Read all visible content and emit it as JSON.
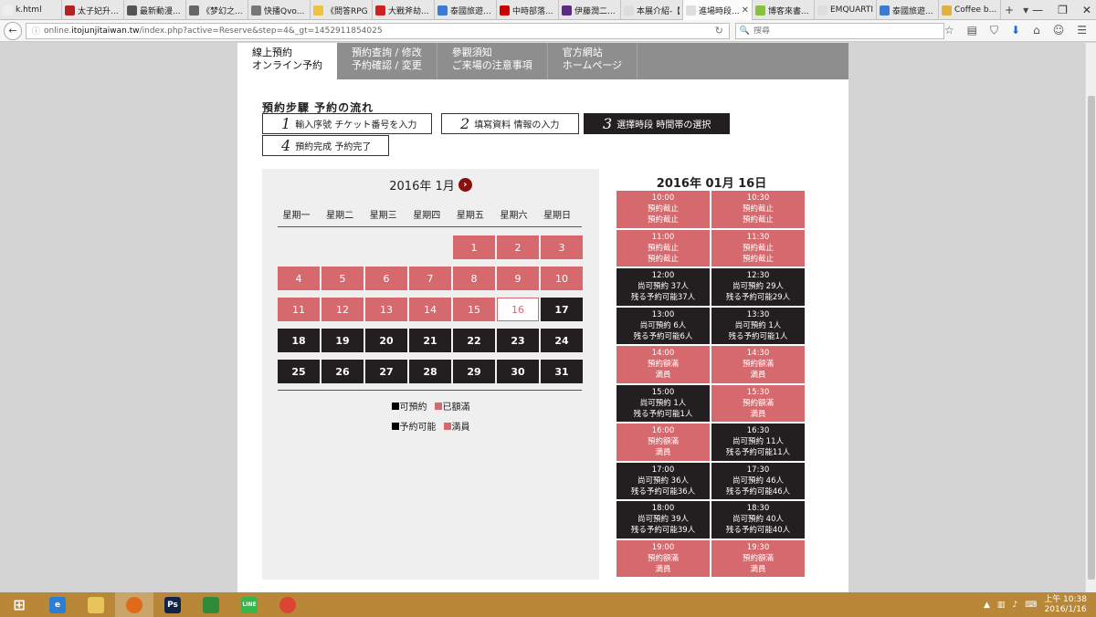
{
  "browser": {
    "tabs": [
      {
        "title": "k.html",
        "color": "#eeeeee"
      },
      {
        "title": "太子妃升...",
        "color": "#b22222"
      },
      {
        "title": "最新動漫...",
        "color": "#555555"
      },
      {
        "title": "《梦幻之...",
        "color": "#666666"
      },
      {
        "title": "快播Qvo...",
        "color": "#777777"
      },
      {
        "title": "《問答RPG ...",
        "color": "#f0c040"
      },
      {
        "title": "大戰斧劫...",
        "color": "#cc2222"
      },
      {
        "title": "泰國旅遊...",
        "color": "#3b7bd4"
      },
      {
        "title": "中時部落...",
        "color": "#cc0000"
      },
      {
        "title": "伊藤潤二...",
        "color": "#5b2a86"
      },
      {
        "title": "本展介紹-【...",
        "color": "#dddddd"
      },
      {
        "title": "進場時段...",
        "color": "#dddddd",
        "active": true
      },
      {
        "title": "博客來書...",
        "color": "#88c040"
      },
      {
        "title": "EMQUARTIER",
        "color": "#dddddd"
      },
      {
        "title": "泰國旅遊...",
        "color": "#3b7bd4"
      },
      {
        "title": "Coffee b...",
        "color": "#e0b040"
      }
    ],
    "new_tab": "+",
    "tab_menu": "▾",
    "url_prefix": "online.",
    "url_domain": "itojunjitaiwan.tw",
    "url_rest": "/index.php?active=Reserve&step=4&_gt=1452911854025",
    "search_placeholder": "搜尋"
  },
  "site": {
    "nav": [
      {
        "zh": "線上預約",
        "ja": "オンライン予約",
        "active": true
      },
      {
        "zh": "預約查詢 / 修改",
        "ja": "予約確認 / 変更"
      },
      {
        "zh": "參觀須知",
        "ja": "ご来場の注意事項"
      },
      {
        "zh": "官方網站",
        "ja": "ホームページ"
      }
    ],
    "steps_title": "預約步驟 予約の流れ",
    "steps": [
      {
        "num": "1",
        "label": "輸入序號 チケット番号を入力"
      },
      {
        "num": "2",
        "label": "填寫資料 情報の入力"
      },
      {
        "num": "3",
        "label": "選擇時段 時間帯の選択"
      },
      {
        "num": "4",
        "label": "預約完成 予約完了"
      }
    ]
  },
  "calendar": {
    "month_label": "2016年 1月",
    "next_icon": "›",
    "weekdays": [
      "星期一",
      "星期二",
      "星期三",
      "星期四",
      "星期五",
      "星期六",
      "星期日"
    ],
    "days": [
      {
        "d": "",
        "s": "blank"
      },
      {
        "d": "",
        "s": "blank"
      },
      {
        "d": "",
        "s": "blank"
      },
      {
        "d": "",
        "s": "blank"
      },
      {
        "d": "1",
        "s": "full"
      },
      {
        "d": "2",
        "s": "full"
      },
      {
        "d": "3",
        "s": "full"
      },
      {
        "d": "4",
        "s": "full"
      },
      {
        "d": "5",
        "s": "full"
      },
      {
        "d": "6",
        "s": "full"
      },
      {
        "d": "7",
        "s": "full"
      },
      {
        "d": "8",
        "s": "full"
      },
      {
        "d": "9",
        "s": "full"
      },
      {
        "d": "10",
        "s": "full"
      },
      {
        "d": "11",
        "s": "full"
      },
      {
        "d": "12",
        "s": "full"
      },
      {
        "d": "13",
        "s": "full"
      },
      {
        "d": "14",
        "s": "full"
      },
      {
        "d": "15",
        "s": "full"
      },
      {
        "d": "16",
        "s": "today"
      },
      {
        "d": "17",
        "s": "open"
      },
      {
        "d": "18",
        "s": "open"
      },
      {
        "d": "19",
        "s": "open"
      },
      {
        "d": "20",
        "s": "open"
      },
      {
        "d": "21",
        "s": "open"
      },
      {
        "d": "22",
        "s": "open"
      },
      {
        "d": "23",
        "s": "open"
      },
      {
        "d": "24",
        "s": "open"
      },
      {
        "d": "25",
        "s": "open"
      },
      {
        "d": "26",
        "s": "open"
      },
      {
        "d": "27",
        "s": "open"
      },
      {
        "d": "28",
        "s": "open"
      },
      {
        "d": "29",
        "s": "open"
      },
      {
        "d": "30",
        "s": "open"
      },
      {
        "d": "31",
        "s": "open"
      }
    ],
    "legend": {
      "open_zh": "可預約",
      "full_zh": "已額滿",
      "open_ja": "予約可能",
      "full_ja": "満員",
      "open_color": "#000000",
      "full_color": "#d6696d"
    }
  },
  "slots": {
    "date_label": "2016年 01月 16日",
    "items": [
      {
        "time": "10:00",
        "l1": "預約截止",
        "l2": "預約截止",
        "s": "full"
      },
      {
        "time": "10:30",
        "l1": "預約截止",
        "l2": "預約截止",
        "s": "full"
      },
      {
        "time": "11:00",
        "l1": "預約截止",
        "l2": "預約截止",
        "s": "full"
      },
      {
        "time": "11:30",
        "l1": "預約截止",
        "l2": "預約截止",
        "s": "full"
      },
      {
        "time": "12:00",
        "l1": "尚可預約 37人",
        "l2": "残る予約可能37人",
        "s": "open"
      },
      {
        "time": "12:30",
        "l1": "尚可預約 29人",
        "l2": "残る予約可能29人",
        "s": "open"
      },
      {
        "time": "13:00",
        "l1": "尚可預約 6人",
        "l2": "残る予約可能6人",
        "s": "open"
      },
      {
        "time": "13:30",
        "l1": "尚可預約 1人",
        "l2": "残る予約可能1人",
        "s": "open"
      },
      {
        "time": "14:00",
        "l1": "預約額滿",
        "l2": "満員",
        "s": "full"
      },
      {
        "time": "14:30",
        "l1": "預約額滿",
        "l2": "満員",
        "s": "full"
      },
      {
        "time": "15:00",
        "l1": "尚可預約 1人",
        "l2": "残る予約可能1人",
        "s": "open"
      },
      {
        "time": "15:30",
        "l1": "預約額滿",
        "l2": "満員",
        "s": "full"
      },
      {
        "time": "16:00",
        "l1": "預約額滿",
        "l2": "満員",
        "s": "full"
      },
      {
        "time": "16:30",
        "l1": "尚可預約 11人",
        "l2": "残る予約可能11人",
        "s": "open"
      },
      {
        "time": "17:00",
        "l1": "尚可預約 36人",
        "l2": "残る予約可能36人",
        "s": "open"
      },
      {
        "time": "17:30",
        "l1": "尚可預約 46人",
        "l2": "残る予約可能46人",
        "s": "open"
      },
      {
        "time": "18:00",
        "l1": "尚可預約 39人",
        "l2": "残る予約可能39人",
        "s": "open"
      },
      {
        "time": "18:30",
        "l1": "尚可預約 40人",
        "l2": "残る予約可能40人",
        "s": "open"
      },
      {
        "time": "19:00",
        "l1": "預約額滿",
        "l2": "満員",
        "s": "full"
      },
      {
        "time": "19:30",
        "l1": "預約額滿",
        "l2": "満員",
        "s": "full"
      }
    ]
  },
  "taskbar": {
    "apps": [
      {
        "name": "windows-start-icon",
        "label": "",
        "color": "#b88737"
      },
      {
        "name": "internet-explorer-icon",
        "label": "e",
        "color": "#2a7fd4"
      },
      {
        "name": "file-explorer-icon",
        "label": "",
        "color": "#e8c45a"
      },
      {
        "name": "firefox-icon",
        "label": "",
        "color": "#e06a1a",
        "active": true
      },
      {
        "name": "photoshop-icon",
        "label": "Ps",
        "color": "#10244a"
      },
      {
        "name": "store-icon",
        "label": "",
        "color": "#2f8a3a"
      },
      {
        "name": "line-icon",
        "label": "LINE",
        "color": "#39b54a"
      },
      {
        "name": "chrome-icon",
        "label": "",
        "color": "#dd4433"
      }
    ],
    "clock_time": "上午 10:38",
    "clock_date": "2016/1/16"
  }
}
